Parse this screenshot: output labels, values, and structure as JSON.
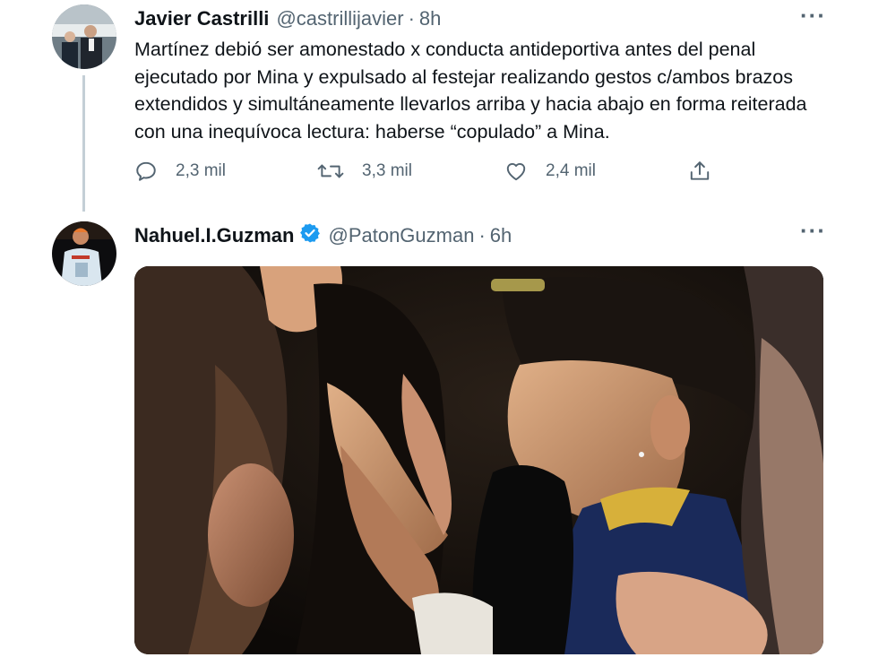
{
  "tweet1": {
    "name": "Javier Castrilli",
    "handle": "@castrillijavier",
    "separator": "·",
    "time": "8h",
    "text": "Martínez debió ser amonestado x conducta antideportiva antes del penal ejecutado por Mina y expulsado al festejar realizando gestos c/ambos brazos extendidos y simultáneamente llevarlos arriba y hacia abajo en forma reiterada con una inequívoca lectura: haberse “copulado” a Mina.",
    "more": "···",
    "actions": {
      "reply_icon": "reply-icon",
      "reply_count": "2,3 mil",
      "retweet_icon": "retweet-icon",
      "retweet_count": "3,3 mil",
      "like_icon": "heart-icon",
      "like_count": "2,4 mil",
      "share_icon": "share-icon"
    }
  },
  "tweet2": {
    "name": "Nahuel.I.Guzman",
    "verified_icon": "verified-badge-icon",
    "handle": "@PatonGuzman",
    "separator": "·",
    "time": "6h",
    "more": "···"
  },
  "colors": {
    "text": "#0f1419",
    "secondary": "#536471",
    "verified": "#1d9bf0",
    "thread_line": "#c4cfd6"
  }
}
